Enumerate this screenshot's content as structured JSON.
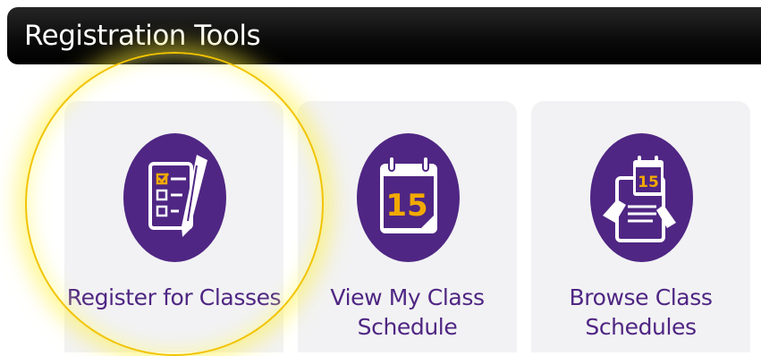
{
  "header": {
    "title": "Registration Tools"
  },
  "tools": [
    {
      "label_line1": "Register for Classes",
      "label_line2": "",
      "icon": "checklist-pen-icon"
    },
    {
      "label_line1": "View My Class",
      "label_line2": "Schedule",
      "icon": "calendar-icon",
      "calendar_day": "15"
    },
    {
      "label_line1": "Browse Class",
      "label_line2": "Schedules",
      "icon": "browse-calendar-icon",
      "calendar_day": "15"
    }
  ],
  "colors": {
    "brand_purple": "#4f2683",
    "accent_gold": "#f2a900",
    "header_bg": "#000000",
    "card_bg": "#f2f2f4",
    "highlight": "#f2c400"
  }
}
